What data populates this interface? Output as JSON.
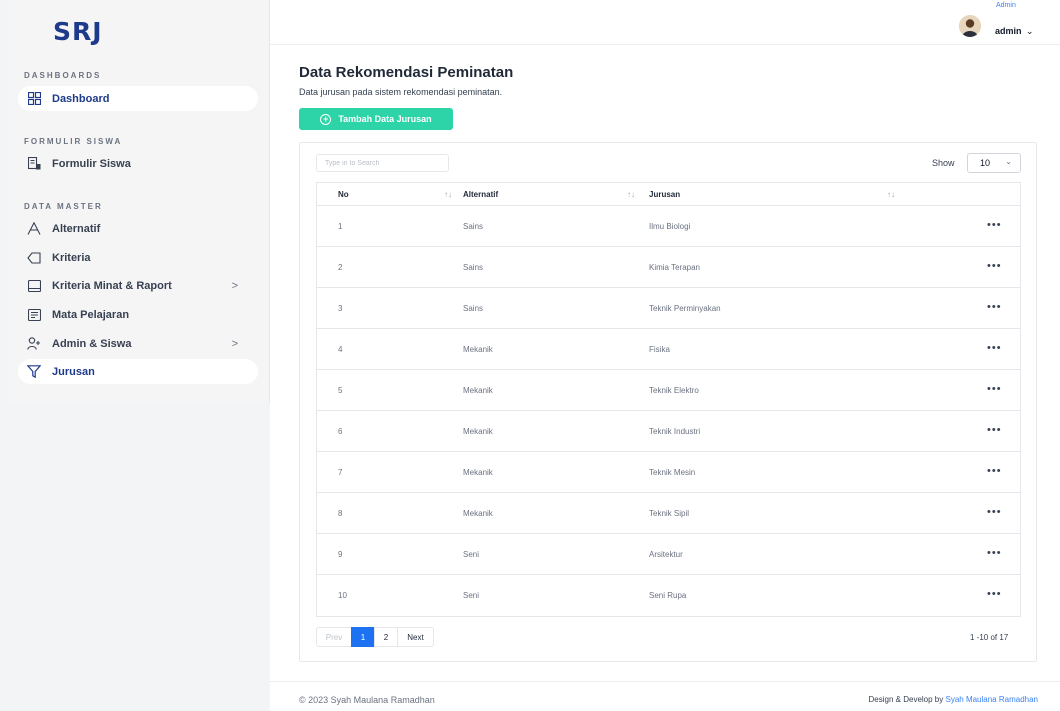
{
  "brand": {
    "logo": "SRJ"
  },
  "sidebar": {
    "sections": [
      "DASHBOARDS",
      "FORMULIR SISWA",
      "DATA MASTER"
    ],
    "items": [
      {
        "label": "Dashboard",
        "icon": "dashboard-grid-icon",
        "active": true
      },
      {
        "label": "Formulir Siswa",
        "icon": "form-icon"
      },
      {
        "label": "Alternatif",
        "icon": "letter-a-icon"
      },
      {
        "label": "Kriteria",
        "icon": "tag-icon"
      },
      {
        "label": "Kriteria Minat & Raport",
        "icon": "window-icon",
        "has_submenu": true
      },
      {
        "label": "Mata Pelajaran",
        "icon": "book-icon"
      },
      {
        "label": "Admin & Siswa",
        "icon": "user-plus-icon",
        "has_submenu": true
      },
      {
        "label": "Jurusan",
        "icon": "filter-icon",
        "active": true
      }
    ],
    "submenu_chevron": ">"
  },
  "header": {
    "role": "Admin",
    "username": "admin",
    "chevron": "⌄"
  },
  "page": {
    "title": "Data Rekomendasi Peminatan",
    "subtitle": "Data jurusan pada sistem rekomendasi peminatan.",
    "add_button": "Tambah Data Jurusan",
    "add_icon": "+"
  },
  "table": {
    "search_placeholder": "Type in to Search",
    "show_label": "Show",
    "page_size": "10",
    "columns": [
      "No",
      "Alternatif",
      "Jurusan"
    ],
    "sort_glyph": "↑↓",
    "action_glyph": "•••",
    "rows": [
      {
        "no": "1",
        "alternatif": "Sains",
        "jurusan": "Ilmu Biologi"
      },
      {
        "no": "2",
        "alternatif": "Sains",
        "jurusan": "Kimia Terapan"
      },
      {
        "no": "3",
        "alternatif": "Sains",
        "jurusan": "Teknik Perminyakan"
      },
      {
        "no": "4",
        "alternatif": "Mekanik",
        "jurusan": "Fisika"
      },
      {
        "no": "5",
        "alternatif": "Mekanik",
        "jurusan": "Teknik Elektro"
      },
      {
        "no": "6",
        "alternatif": "Mekanik",
        "jurusan": "Teknik Industri"
      },
      {
        "no": "7",
        "alternatif": "Mekanik",
        "jurusan": "Teknik Mesin"
      },
      {
        "no": "8",
        "alternatif": "Mekanik",
        "jurusan": "Teknik Sipil"
      },
      {
        "no": "9",
        "alternatif": "Seni",
        "jurusan": "Arsitektur"
      },
      {
        "no": "10",
        "alternatif": "Seni",
        "jurusan": "Seni Rupa"
      }
    ]
  },
  "pagination": {
    "prev": "Prev",
    "pages": [
      "1",
      "2"
    ],
    "current": "1",
    "next": "Next",
    "range": "1 -10 of 17"
  },
  "footer": {
    "copyright": "© 2023 Syah Maulana Ramadhan",
    "credit_prefix": "Design & Develop by",
    "credit_name": "Syah Maulana Ramadhan"
  },
  "colors": {
    "accent": "#2dd4a7",
    "primary": "#1d72f2",
    "brand": "#1e3a8a",
    "link": "#3b82f6"
  }
}
